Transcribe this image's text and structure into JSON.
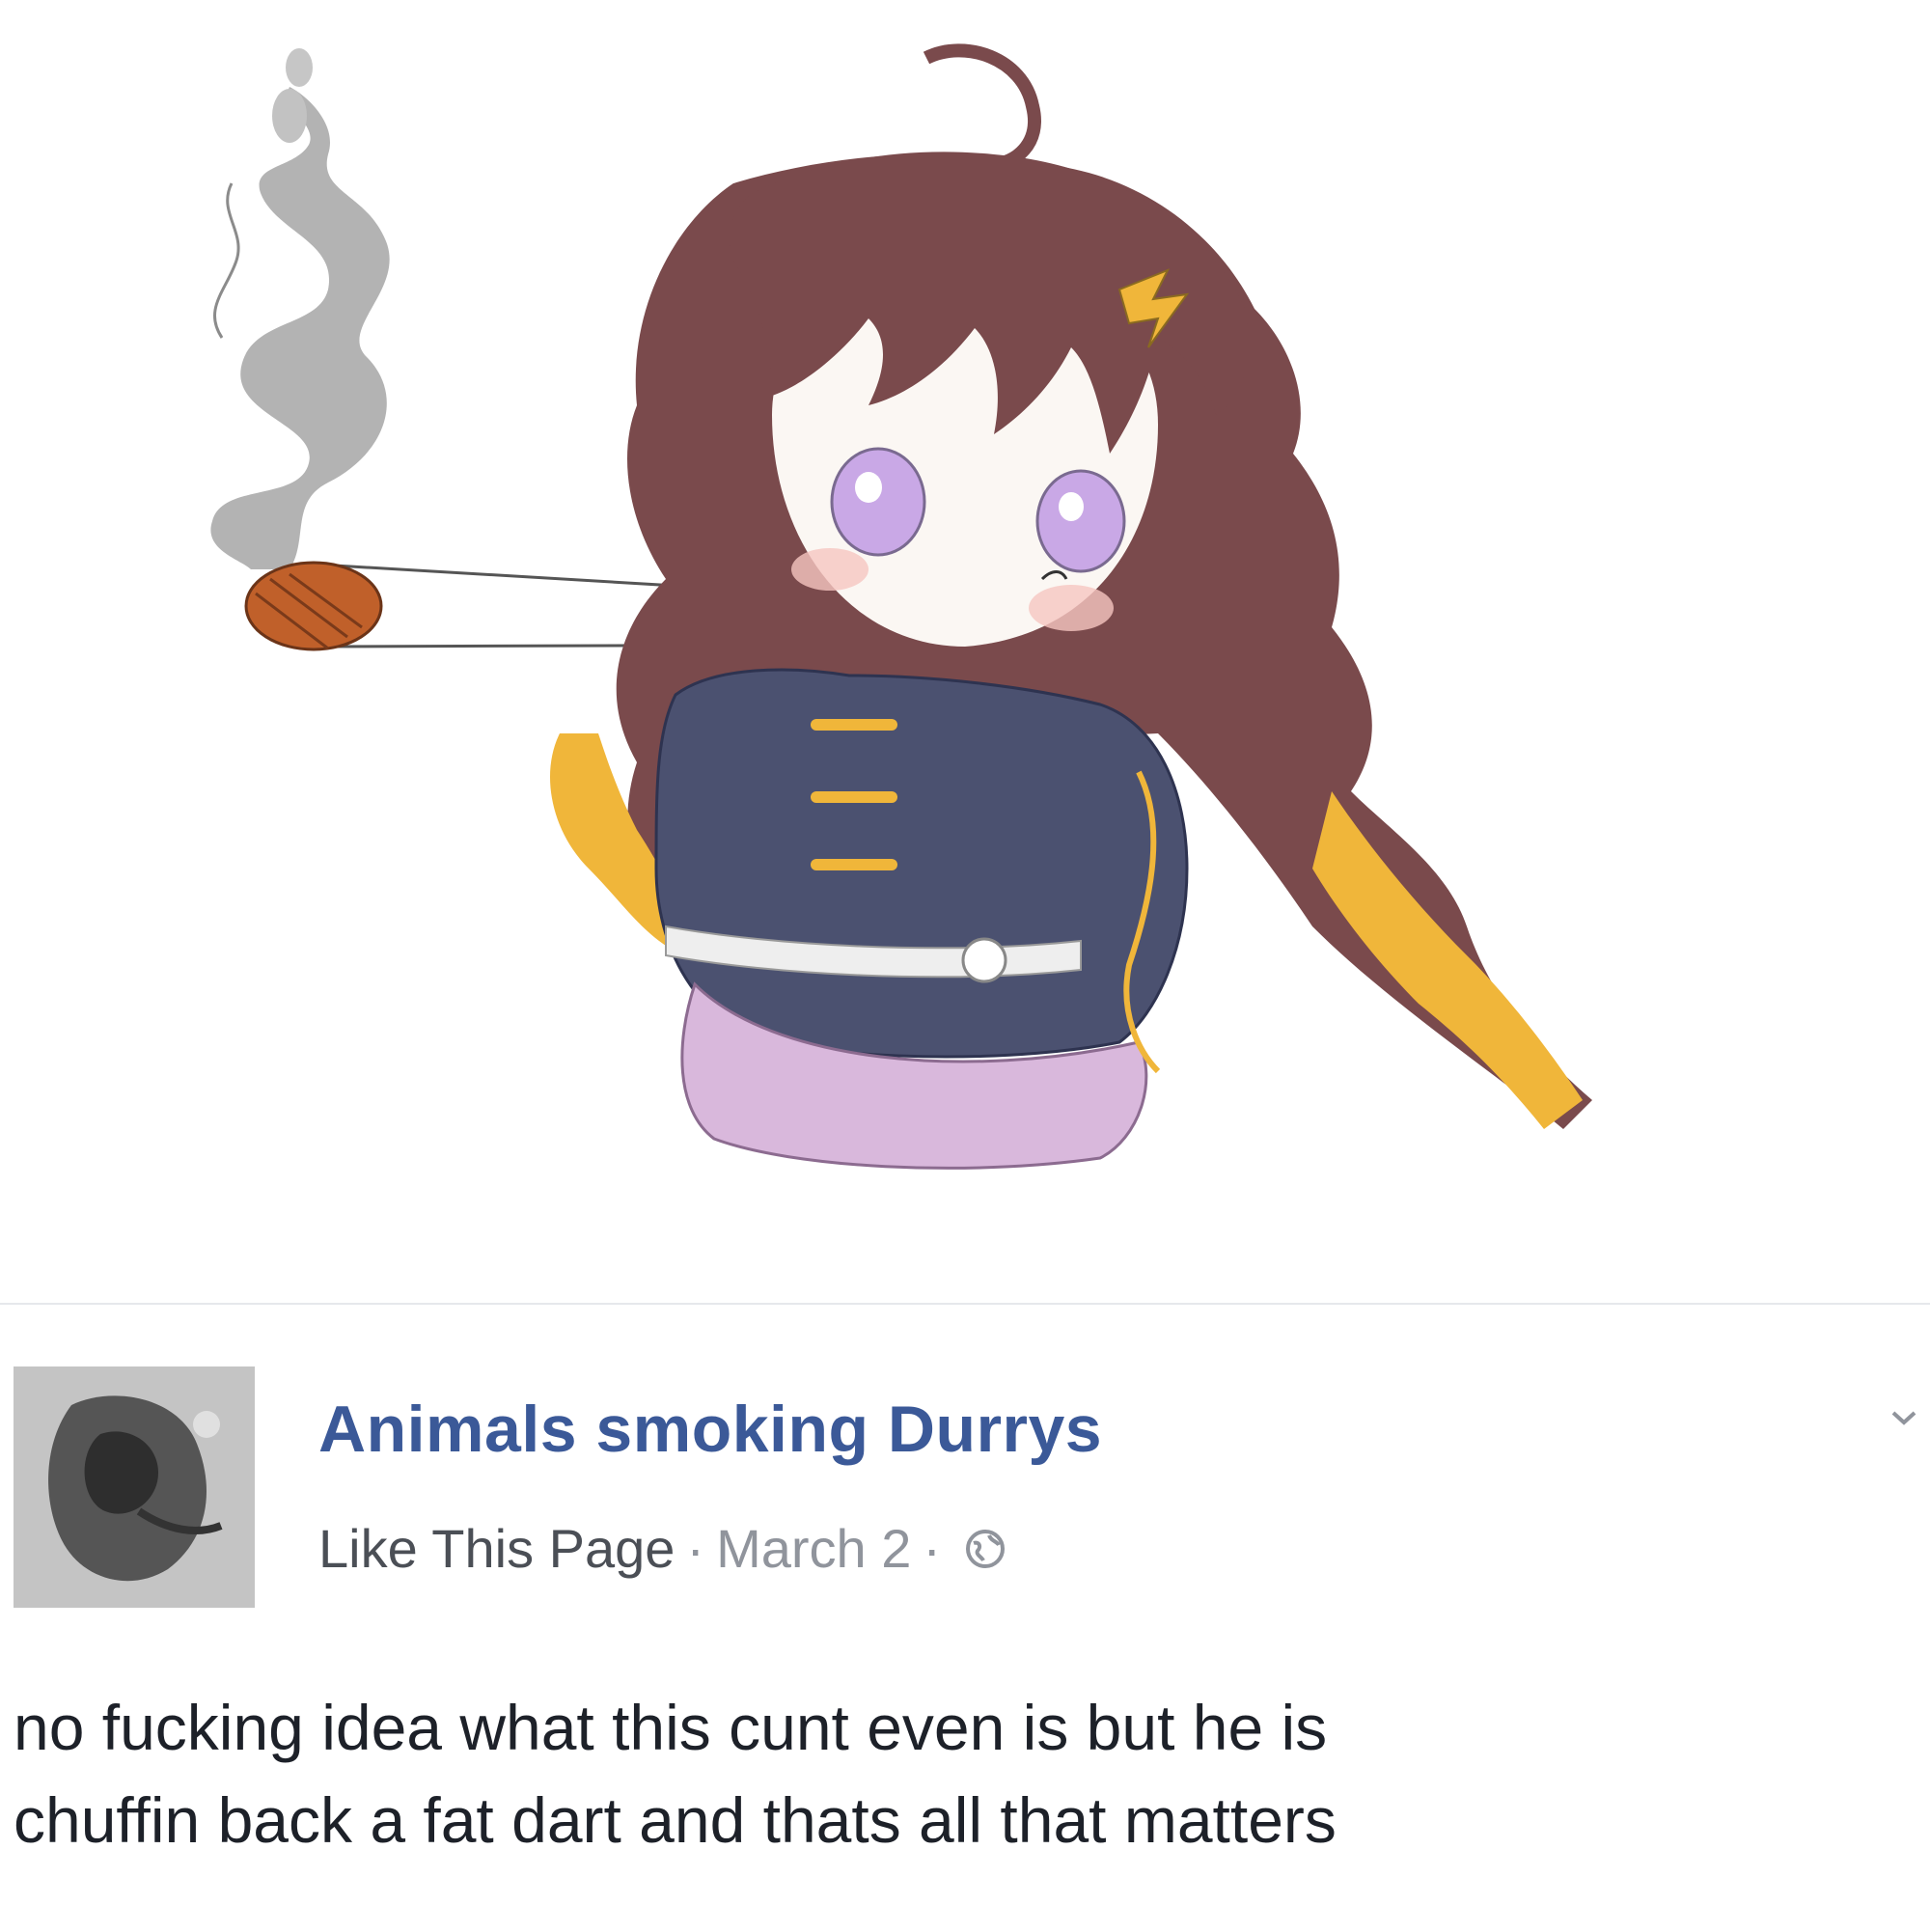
{
  "post": {
    "page_name": "Animals smoking Durrys",
    "like_page_label": "Like This Page",
    "separator": "·",
    "date": "March 2",
    "privacy_icon": "globe-icon",
    "menu_icon": "chevron-down-icon",
    "text_lines": [
      "no fucking idea what this cunt even is but he is",
      "chuffin back a fat dart and thats all that matters"
    ]
  },
  "colors": {
    "page_name": "#3b5998",
    "meta_text": "#90949c",
    "like_link": "#4b4f56",
    "body_text": "#1d2129",
    "hair": "#7a4a4c",
    "hair_tips": "#f0b63a",
    "jacket": "#4b5170",
    "skirt": "#d9b8dc",
    "eyes": "#c9a8e6",
    "smoke": "#9a9a9a",
    "ember": "#c0602a"
  }
}
